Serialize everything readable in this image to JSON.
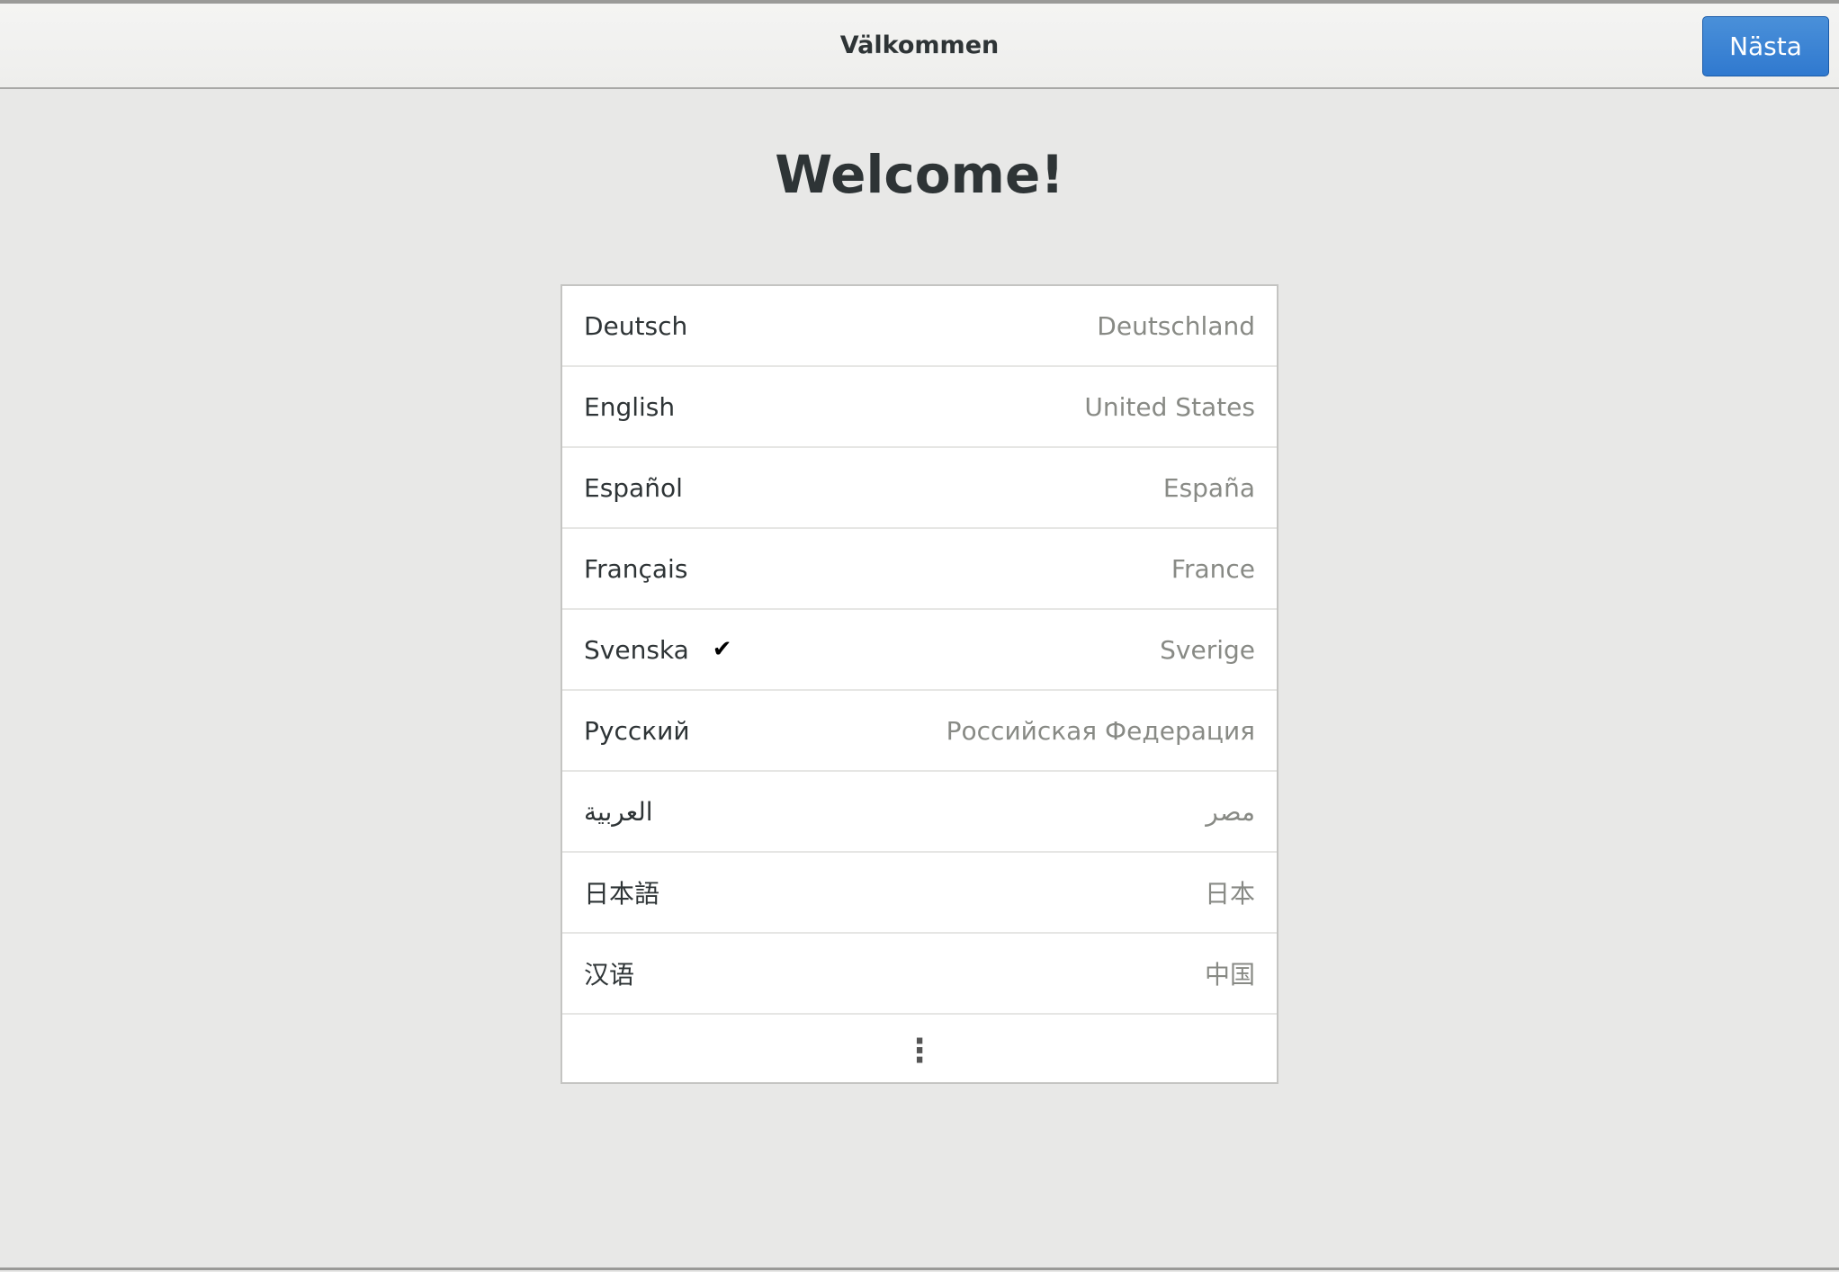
{
  "header": {
    "title": "Välkommen",
    "next_label": "Nästa"
  },
  "main": {
    "heading": "Welcome!",
    "languages": [
      {
        "language": "Deutsch",
        "region": "Deutschland",
        "selected": false
      },
      {
        "language": "English",
        "region": "United States",
        "selected": false
      },
      {
        "language": "Español",
        "region": "España",
        "selected": false
      },
      {
        "language": "Français",
        "region": "France",
        "selected": false
      },
      {
        "language": "Svenska",
        "region": "Sverige",
        "selected": true
      },
      {
        "language": "Русский",
        "region": "Российская Федерация",
        "selected": false
      },
      {
        "language": "العربية",
        "region": "مصر",
        "selected": false
      },
      {
        "language": "日本語",
        "region": "日本",
        "selected": false
      },
      {
        "language": "汉语",
        "region": "中国",
        "selected": false
      }
    ],
    "check_glyph": "✔",
    "more_glyph": "⋮"
  }
}
